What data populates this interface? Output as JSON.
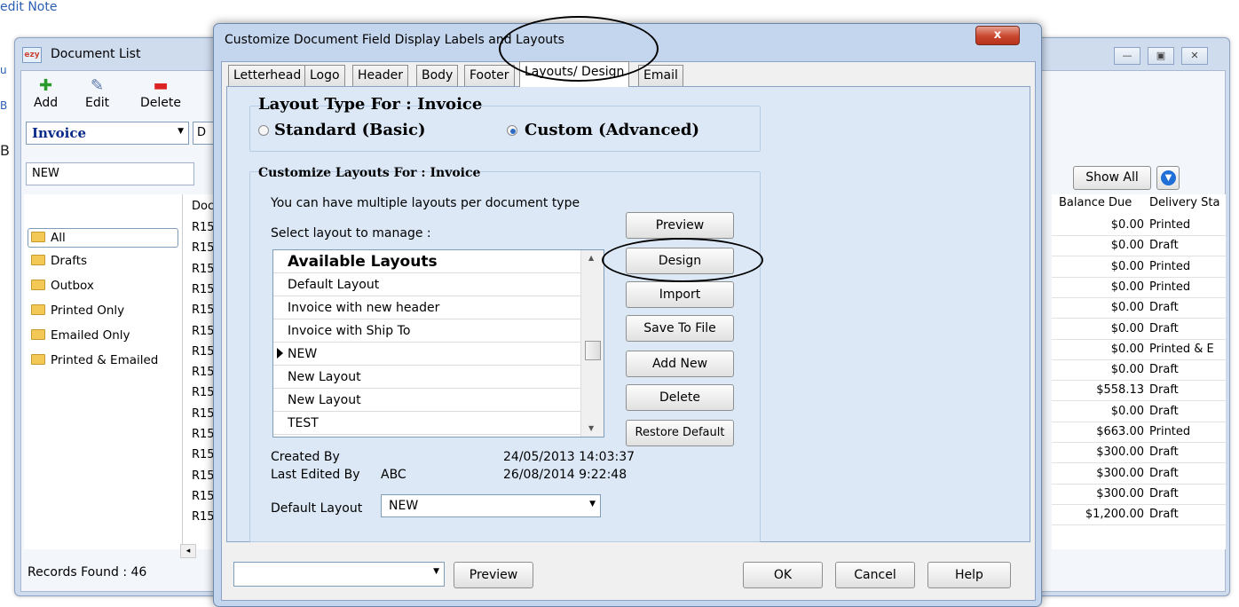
{
  "background": {
    "text_credit_note": "edit Note",
    "window_title": "Document List",
    "app_icon": "ezy",
    "toolbar": {
      "add": "Add",
      "edit": "Edit",
      "delete": "Delete"
    },
    "doc_type": "Invoice",
    "doc_type_hint": "D",
    "search_value": "NEW",
    "folders": [
      "All",
      "Drafts",
      "Outbox",
      "Printed Only",
      "Emailed Only",
      "Printed & Emailed"
    ],
    "col_doc_header": "Doc",
    "doc_prefix": "R15",
    "show_all_label": "Show All",
    "col_balance_header": "Balance Due",
    "col_delivery_header": "Delivery Sta",
    "rows": [
      {
        "balance": "$0.00",
        "status": "Printed"
      },
      {
        "balance": "$0.00",
        "status": "Draft"
      },
      {
        "balance": "$0.00",
        "status": "Printed"
      },
      {
        "balance": "$0.00",
        "status": "Printed"
      },
      {
        "balance": "$0.00",
        "status": "Draft"
      },
      {
        "balance": "$0.00",
        "status": "Draft"
      },
      {
        "balance": "$0.00",
        "status": "Printed & E"
      },
      {
        "balance": "$0.00",
        "status": "Draft"
      },
      {
        "balance": "$558.13",
        "status": "Draft"
      },
      {
        "balance": "$0.00",
        "status": "Draft"
      },
      {
        "balance": "$663.00",
        "status": "Printed"
      },
      {
        "balance": "$300.00",
        "status": "Draft"
      },
      {
        "balance": "$300.00",
        "status": "Draft"
      },
      {
        "balance": "$300.00",
        "status": "Draft"
      },
      {
        "balance": "$1,200.00",
        "status": "Draft"
      }
    ],
    "records_found": "Records Found : 46",
    "left_edge_letters": [
      "u",
      "B",
      "B"
    ]
  },
  "dialog": {
    "title": "Customize Document Field Display Labels and Layouts",
    "close_glyph": "x",
    "tabs": [
      "Letterhead",
      "Logo",
      "Header",
      "Body",
      "Footer",
      "Layouts/ Design",
      "Email"
    ],
    "active_tab": "Layouts/ Design",
    "layout_type_title": "Layout Type For : Invoice",
    "radio_standard": "Standard (Basic)",
    "radio_custom": "Custom (Advanced)",
    "custom_selected": true,
    "customize_title": "Customize Layouts For : Invoice",
    "hint_multiple": "You can have multiple layouts per document type",
    "hint_select": "Select layout to manage :",
    "list_header": "Available Layouts",
    "layouts": [
      "Default Layout",
      "Invoice with new header",
      "Invoice with Ship To",
      "NEW",
      "New Layout",
      "New Layout",
      "TEST"
    ],
    "selected_layout": "NEW",
    "buttons": [
      "Preview",
      "Design",
      "Import",
      "Save To File",
      "Add New",
      "Delete",
      "Restore Default"
    ],
    "created_by_label": "Created By",
    "created_by_value": "",
    "created_date": "24/05/2013 14:03:37",
    "last_edited_label": "Last Edited By",
    "last_edited_value": "ABC",
    "last_edited_date": "26/08/2014 9:22:48",
    "default_layout_label": "Default Layout",
    "default_layout_value": "NEW",
    "footer": {
      "combo_value": "",
      "preview": "Preview",
      "ok": "OK",
      "cancel": "Cancel",
      "help": "Help"
    }
  }
}
